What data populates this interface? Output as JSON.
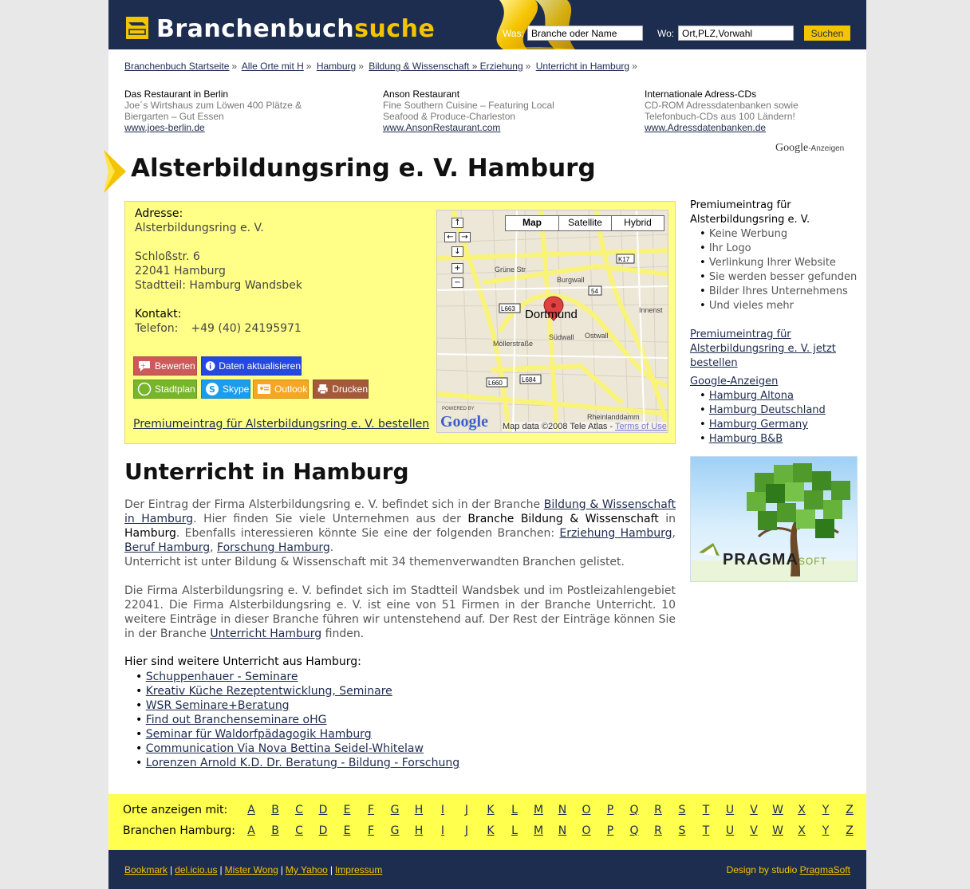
{
  "header": {
    "logo_main": "Branchenbuch",
    "logo_accent": "suche",
    "was_label": "Was:",
    "was_value": "Branche oder Name",
    "wo_label": "Wo:",
    "wo_value": "Ort,PLZ,Vorwahl",
    "search_label": "Suchen"
  },
  "breadcrumb": [
    "Branchenbuch Startseite",
    "Alle Orte mit H",
    "Hamburg",
    "Bildung & Wissenschaft » Erziehung",
    "Unterricht in Hamburg"
  ],
  "ads": [
    {
      "title": "Das Restaurant in Berlin",
      "text": "Joe´s Wirtshaus zum Löwen 400 Plätze & Biergarten – Gut Essen",
      "url": "www.joes-berlin.de"
    },
    {
      "title": "Anson Restaurant",
      "text": "Fine Southern Cuisine – Featuring Local Seafood & Produce-Charleston",
      "url": "www.AnsonRestaurant.com"
    },
    {
      "title": "Internationale Adress-CDs",
      "text": "CD-ROM Adressdatenbanken sowie Telefonbuch-CDs aus 100 Ländern!",
      "url": "www.Adressdatenbanken.de"
    }
  ],
  "google_ads_label": {
    "brand": "Google",
    "suffix": "-Anzeigen"
  },
  "page_title": "Alsterbildungsring e. V. Hamburg",
  "info": {
    "address_label": "Adresse:",
    "name": "Alsterbildungsring e. V.",
    "street": "Schloßstr. 6",
    "city": "22041 Hamburg",
    "district": "Stadtteil: Hamburg Wandsbek",
    "contact_label": "Kontakt:",
    "phone_label": "Telefon:",
    "phone": "+49 (40) 24195971",
    "premium_link": "Premiumeintrag für Alsterbildungsring e. V. bestellen"
  },
  "actions": {
    "rate": "Bewerten",
    "update": "Daten aktualisieren",
    "map": "Stadtplan",
    "skype": "Skype",
    "outlook": "Outlook",
    "print": "Drucken"
  },
  "map": {
    "tabs": [
      "Map",
      "Satellite",
      "Hybrid"
    ],
    "city": "Dortmund",
    "copyright": "Map data ©2008 Tele Atlas - ",
    "terms": "Terms of Use",
    "powered": "POWERED BY",
    "google": "Google",
    "roads": [
      "K17",
      "54",
      "L663",
      "L660",
      "L684"
    ],
    "streets": [
      "Grüne Str",
      "Burgwall",
      "Südwall",
      "Ostwall",
      "Rheinlanddamm",
      "Innenst",
      "Möllerstraße"
    ]
  },
  "section_title": "Unterricht in Hamburg",
  "content": {
    "p1_a": "Der Eintrag der Firma Alsterbildungsring e. V. befindet sich in der Branche ",
    "p1_link1": "Bildung & Wissenschaft in Hamburg",
    "p1_b": ". Hier finden Sie viele Unternehmen aus der ",
    "p1_dark1": "Branche Bildung & Wissenschaft",
    "p1_c": " in ",
    "p1_dark2": "Hamburg",
    "p1_d": ". Ebenfalls interessieren könnte Sie eine der folgenden Branchen: ",
    "p1_link2": "Erziehung Hamburg",
    "p1_e": ", ",
    "p1_link3": "Beruf Hamburg",
    "p1_f": ", ",
    "p1_link4": "Forschung Hamburg",
    "p1_g": ".",
    "p1_h": "Unterricht ist unter Bildung & Wissenschaft mit 34 themenverwandten Branchen gelistet.",
    "p2_a": "Die Firma Alsterbildungsring e. V. befindet sich im Stadtteil Wandsbek und im Postleizahlengebiet 22041. Die Firma Alsterbildungsring e. V. ist eine von 51 Firmen in der Branche Unterricht. 10 weitere Einträge in dieser Branche führen wir untenstehend auf. Der Rest der Einträge können Sie in der Branche ",
    "p2_link": "Unterricht Hamburg",
    "p2_b": " finden."
  },
  "more": {
    "title": "Hier sind weitere Unterricht aus Hamburg:",
    "items": [
      "Schuppenhauer - Seminare",
      "Kreativ Küche Rezeptentwicklung, Seminare",
      "WSR Seminare+Beratung",
      "Find out Branchenseminare oHG",
      "Seminar für Waldorfpädagogik Hamburg",
      "Communication Via Nova Bettina Seidel-Whitelaw",
      "Lorenzen Arnold K.D. Dr. Beratung - Bildung - Forschung"
    ]
  },
  "sidebar": {
    "premium_title": "Premiumeintrag für Alsterbildungsring e. V.",
    "premium_items": [
      "Keine Werbung",
      "Ihr Logo",
      "Verlinkung Ihrer Website",
      "Sie werden besser gefunden",
      "Bilder Ihres Unternehmens",
      "Und vieles mehr"
    ],
    "premium_order": "Premiumeintrag für Alsterbildungsring e. V. jetzt bestellen",
    "gads_title": "Google-Anzeigen",
    "gads_items": [
      "Hamburg Altona",
      "Hamburg Deutschland",
      "Hamburg Germany",
      "Hamburg B&B"
    ],
    "banner_brand": "PRAGMA",
    "banner_soft": "SOFT"
  },
  "alphabet": {
    "orte_label": "Orte anzeigen mit:",
    "branchen_label": "Branchen Hamburg:",
    "letters": [
      "A",
      "B",
      "C",
      "D",
      "E",
      "F",
      "G",
      "H",
      "I",
      "J",
      "K",
      "L",
      "M",
      "N",
      "O",
      "P",
      "Q",
      "R",
      "S",
      "T",
      "U",
      "V",
      "W",
      "X",
      "Y",
      "Z"
    ]
  },
  "footer": {
    "links": [
      "Bookmark",
      "del.icio.us",
      "Mister Wong",
      "My Yahoo",
      "Impressum"
    ],
    "credit_prefix": "Design by studio ",
    "credit_link": "PragmaSoft"
  },
  "colors": {
    "navy": "#1c2d4f",
    "yellow": "#f5c400",
    "info_bg": "#ffff88",
    "alpha_bg": "#ffff4d"
  }
}
